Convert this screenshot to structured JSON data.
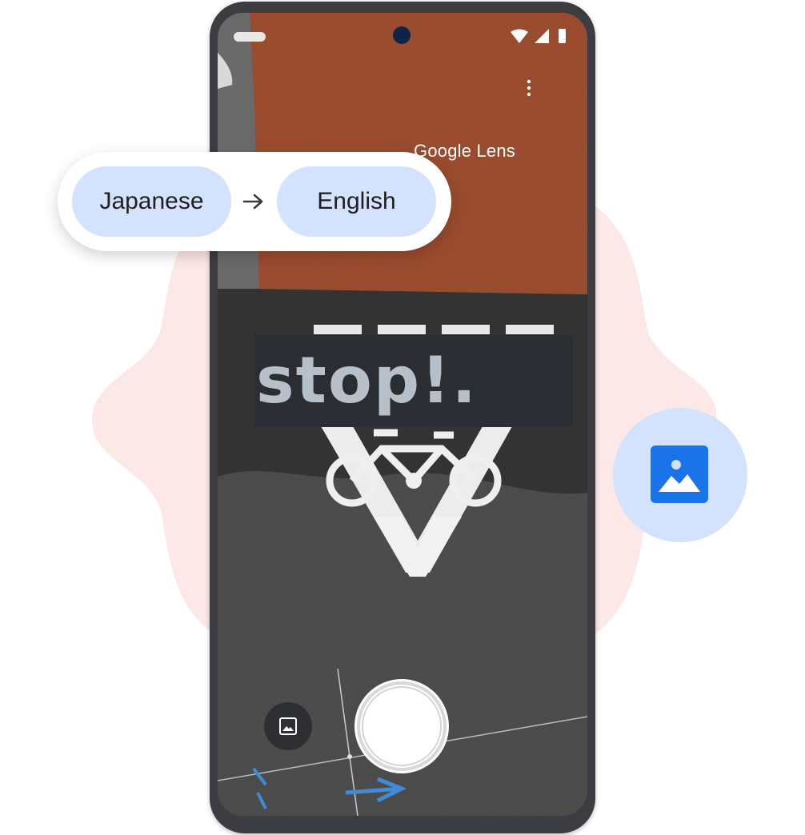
{
  "app": {
    "title": "Google Lens"
  },
  "translation": {
    "source_language": "Japanese",
    "target_language": "English",
    "translated_text": "stop!."
  },
  "icons": {
    "more": "more-vert-icon",
    "gallery": "image-icon",
    "floating": "image-icon",
    "arrow": "arrow-right-icon"
  },
  "colors": {
    "accent_blue": "#1a73e8",
    "chip_bg": "#d3e3fd",
    "blob_pink": "#fce8e6",
    "phone_frame": "#3b3d42"
  }
}
